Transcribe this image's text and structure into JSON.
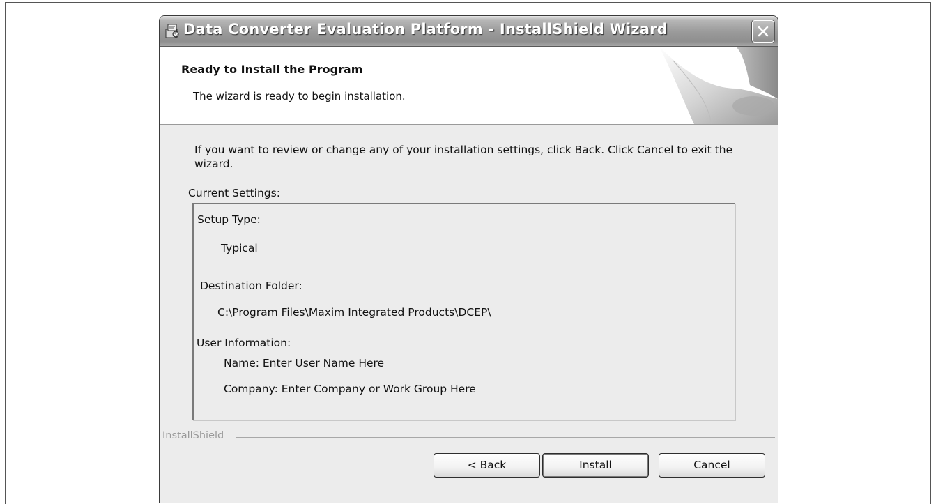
{
  "window": {
    "title": "Data Converter Evaluation Platform - InstallShield Wizard"
  },
  "header": {
    "title": "Ready to Install the Program",
    "subtitle": "The wizard is ready to begin installation."
  },
  "main": {
    "instructions": "If you want to review or change any of your installation settings, click Back. Click Cancel to exit the wizard.",
    "current_settings_label": "Current Settings:",
    "settings": {
      "setup_type_label": "Setup Type:",
      "setup_type_value": "Typical",
      "destination_label": "Destination Folder:",
      "destination_value": "C:\\Program Files\\Maxim Integrated Products\\DCEP\\",
      "user_info_label": "User Information:",
      "name_line": "Name: Enter User Name Here",
      "company_line": "Company: Enter Company or Work Group Here"
    }
  },
  "footer": {
    "brand_label": "InstallShield",
    "back_label": "< Back",
    "install_label": "Install",
    "cancel_label": "Cancel"
  },
  "icons": {
    "app": "installer-icon",
    "close": "close-icon"
  }
}
